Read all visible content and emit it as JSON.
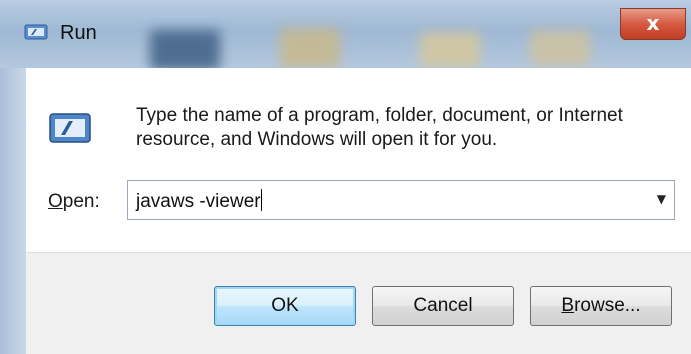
{
  "window": {
    "title": "Run",
    "close_glyph": "x"
  },
  "dialog": {
    "description_line1": "Type the name of a program, folder, document, or Internet",
    "description_line2": "resource, and Windows will open it for you.",
    "open_label_mnemonic": "O",
    "open_label_rest": "pen:",
    "input_value": "javaws -viewer",
    "dropdown_glyph": "▼"
  },
  "buttons": {
    "ok": "OK",
    "cancel": "Cancel",
    "browse_mnemonic": "B",
    "browse_rest": "rowse..."
  },
  "icons": {
    "title_icon": "run-icon",
    "dialog_icon": "run-program-icon",
    "dropdown_icon": "chevron-down-icon"
  },
  "colors": {
    "close_button": "#c94a30",
    "ok_button_border": "#3c7fb1",
    "titlebar": "#a9bfd8"
  }
}
